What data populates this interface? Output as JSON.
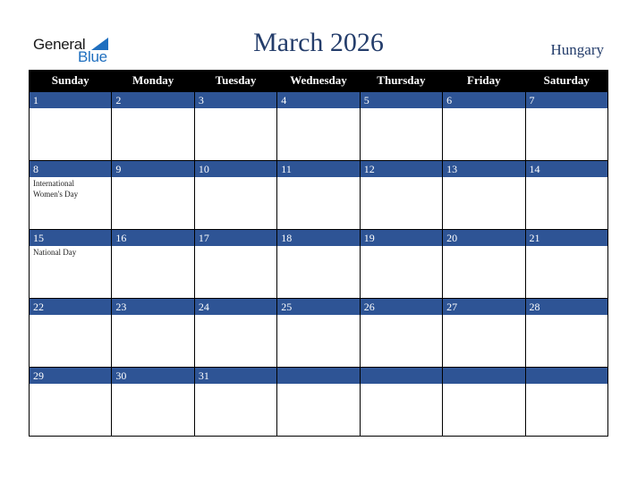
{
  "logo": {
    "line1": "General",
    "line2": "Blue"
  },
  "header": {
    "title": "March 2026",
    "country": "Hungary"
  },
  "colors": {
    "header_bg": "#000000",
    "daynum_bg": "#2e5495",
    "title": "#243d6b",
    "logo_blue": "#1f6fbf"
  },
  "weekdays": [
    "Sunday",
    "Monday",
    "Tuesday",
    "Wednesday",
    "Thursday",
    "Friday",
    "Saturday"
  ],
  "weeks": [
    [
      {
        "day": "1",
        "event": ""
      },
      {
        "day": "2",
        "event": ""
      },
      {
        "day": "3",
        "event": ""
      },
      {
        "day": "4",
        "event": ""
      },
      {
        "day": "5",
        "event": ""
      },
      {
        "day": "6",
        "event": ""
      },
      {
        "day": "7",
        "event": ""
      }
    ],
    [
      {
        "day": "8",
        "event": "International Women's Day"
      },
      {
        "day": "9",
        "event": ""
      },
      {
        "day": "10",
        "event": ""
      },
      {
        "day": "11",
        "event": ""
      },
      {
        "day": "12",
        "event": ""
      },
      {
        "day": "13",
        "event": ""
      },
      {
        "day": "14",
        "event": ""
      }
    ],
    [
      {
        "day": "15",
        "event": "National Day"
      },
      {
        "day": "16",
        "event": ""
      },
      {
        "day": "17",
        "event": ""
      },
      {
        "day": "18",
        "event": ""
      },
      {
        "day": "19",
        "event": ""
      },
      {
        "day": "20",
        "event": ""
      },
      {
        "day": "21",
        "event": ""
      }
    ],
    [
      {
        "day": "22",
        "event": ""
      },
      {
        "day": "23",
        "event": ""
      },
      {
        "day": "24",
        "event": ""
      },
      {
        "day": "25",
        "event": ""
      },
      {
        "day": "26",
        "event": ""
      },
      {
        "day": "27",
        "event": ""
      },
      {
        "day": "28",
        "event": ""
      }
    ],
    [
      {
        "day": "29",
        "event": ""
      },
      {
        "day": "30",
        "event": ""
      },
      {
        "day": "31",
        "event": ""
      },
      {
        "day": "",
        "event": ""
      },
      {
        "day": "",
        "event": ""
      },
      {
        "day": "",
        "event": ""
      },
      {
        "day": "",
        "event": ""
      }
    ]
  ]
}
